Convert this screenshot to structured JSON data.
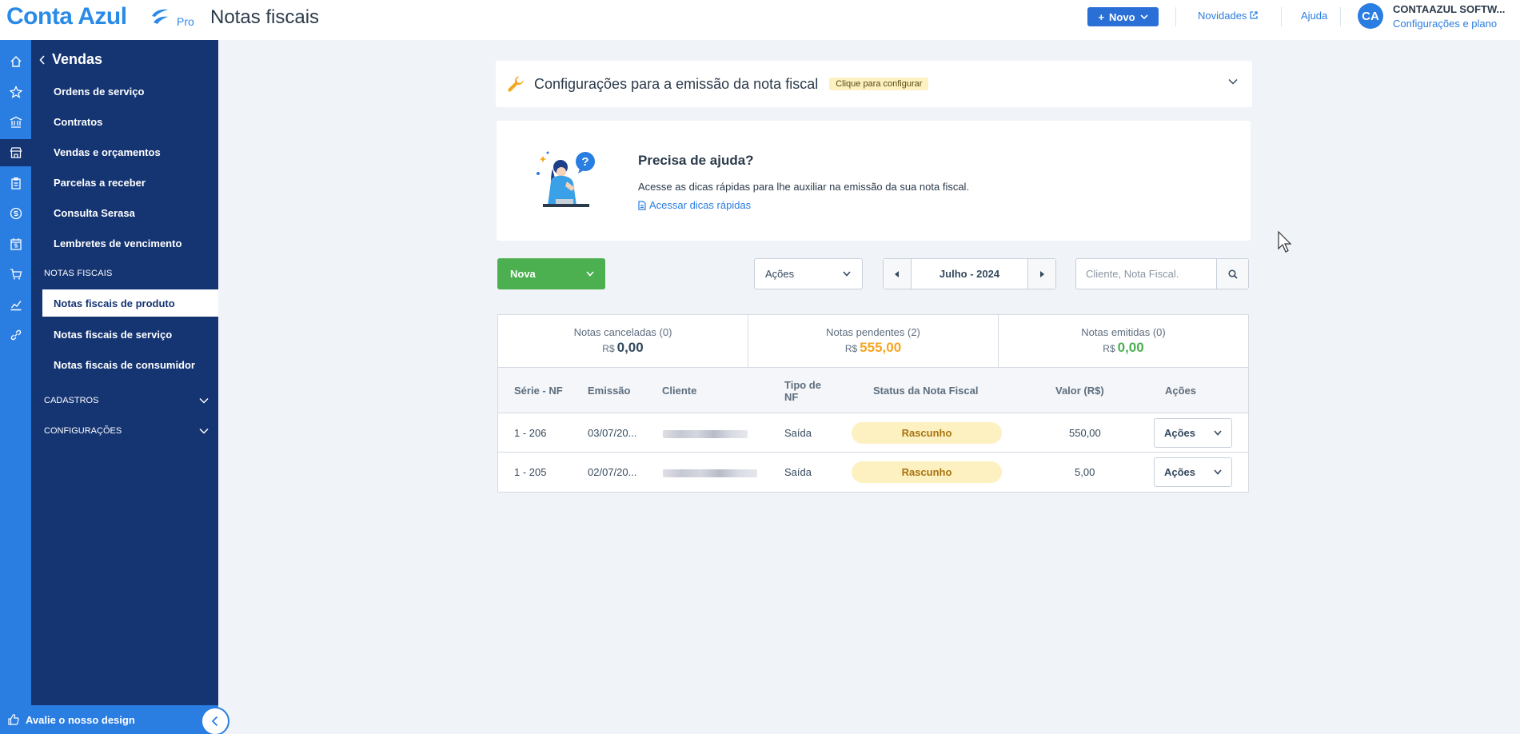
{
  "header": {
    "brand": "Conta Azul",
    "brand_tier": "Pro",
    "page_title": "Notas fiscais",
    "new_button": "Novo",
    "news_link": "Novidades",
    "help_link": "Ajuda",
    "avatar_initials": "CA",
    "company_name": "CONTAAZUL SOFTW...",
    "company_link": "Configurações e plano"
  },
  "rail": {
    "icons": [
      "home-icon",
      "star-icon",
      "bank-icon",
      "store-icon",
      "clipboard-icon",
      "coin-icon",
      "calendar-money-icon",
      "cart-icon",
      "chart-icon",
      "link-icon"
    ],
    "active_index": 3
  },
  "sidebar": {
    "back_label": "Vendas",
    "items": [
      {
        "label": "Ordens de serviço"
      },
      {
        "label": "Contratos"
      },
      {
        "label": "Vendas e orçamentos"
      },
      {
        "label": "Parcelas a receber"
      },
      {
        "label": "Consulta Serasa"
      },
      {
        "label": "Lembretes de vencimento"
      }
    ],
    "section_notas": "NOTAS FISCAIS",
    "notas_items": [
      {
        "label": "Notas fiscais de produto",
        "active": true
      },
      {
        "label": "Notas fiscais de serviço"
      },
      {
        "label": "Notas fiscais de consumidor"
      }
    ],
    "section_cadastros": "CADASTROS",
    "section_config": "CONFIGURAÇÕES",
    "feedback": "Avalie o nosso design"
  },
  "config_card": {
    "title": "Configurações para a emissão da nota fiscal",
    "badge": "Clique para configurar"
  },
  "help_card": {
    "title": "Precisa de ajuda?",
    "text": "Acesse as dicas rápidas para lhe auxiliar na emissão da sua nota fiscal.",
    "link": "Acessar dicas rápidas"
  },
  "toolbar": {
    "nova_label": "Nova",
    "acoes_label": "Ações",
    "month_label": "Julho - 2024",
    "search_placeholder": "Cliente, Nota Fiscal."
  },
  "summary": [
    {
      "label": "Notas canceladas (0)",
      "currency": "R$",
      "amount": "0,00",
      "color": "#34495e"
    },
    {
      "label": "Notas pendentes (2)",
      "currency": "R$",
      "amount": "555,00",
      "color": "#f5a623"
    },
    {
      "label": "Notas emitidas (0)",
      "currency": "R$",
      "amount": "0,00",
      "color": "#4caf50"
    }
  ],
  "table": {
    "headers": {
      "serie": "Série - NF",
      "emissao": "Emissão",
      "cliente": "Cliente",
      "tipo_line1": "Tipo de",
      "tipo_line2": "NF",
      "status": "Status da Nota Fiscal",
      "valor": "Valor (R$)",
      "acoes": "Ações"
    },
    "rows": [
      {
        "serie": "1 - 206",
        "emissao": "03/07/20...",
        "tipo": "Saída",
        "status": "Rascunho",
        "valor": "550,00",
        "acoes": "Ações"
      },
      {
        "serie": "1 - 205",
        "emissao": "02/07/20...",
        "tipo": "Saída",
        "status": "Rascunho",
        "valor": "5,00",
        "acoes": "Ações"
      }
    ]
  },
  "colors": {
    "brand_blue": "#2a7de1",
    "sidebar_navy": "#143472",
    "success_green": "#4caf50",
    "pending_orange": "#f5a623",
    "draft_badge": "#fdf1c2"
  }
}
